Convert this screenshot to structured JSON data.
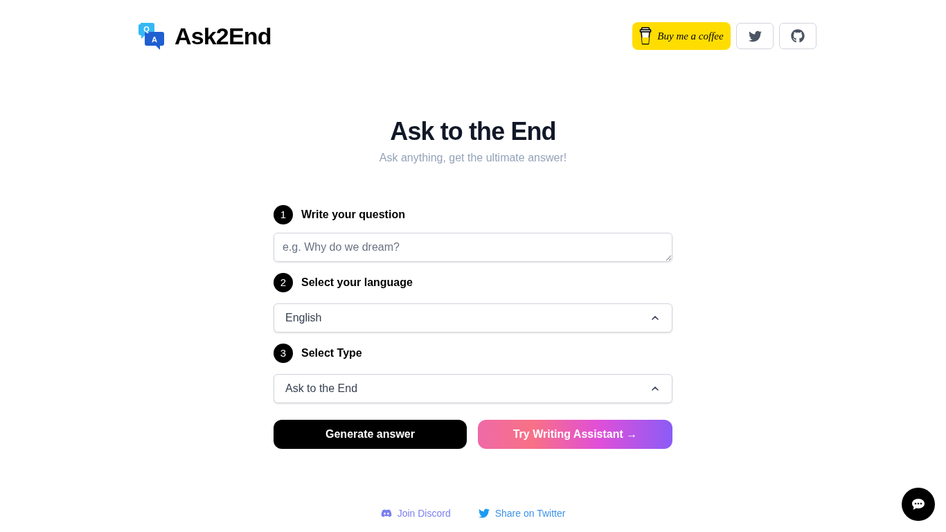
{
  "header": {
    "logo": {
      "icon_letters": [
        "Q",
        "A"
      ],
      "name": "Ask2End"
    },
    "buttons": [
      {
        "kind": "coffee",
        "label": "Buy me a coffee"
      },
      {
        "kind": "twitter"
      },
      {
        "kind": "github"
      }
    ]
  },
  "hero": {
    "title": "Ask to the End",
    "subtitle": "Ask anything, get the ultimate answer!"
  },
  "form": {
    "steps": [
      {
        "number": "1",
        "label": "Write your question",
        "kind": "textarea",
        "placeholder": "e.g. Why do we dream?"
      },
      {
        "number": "2",
        "label": "Select your language",
        "kind": "select",
        "value": "English"
      },
      {
        "number": "3",
        "label": "Select Type",
        "kind": "select",
        "value": "Ask to the End"
      }
    ],
    "buttons": [
      {
        "kind": "primary",
        "label": "Generate answer"
      },
      {
        "kind": "gradient",
        "label": "Try Writing Assistant →"
      }
    ]
  },
  "footer": {
    "links": [
      {
        "kind": "discord",
        "label": "Join Discord"
      },
      {
        "kind": "twitter",
        "label": "Share on Twitter"
      }
    ]
  }
}
